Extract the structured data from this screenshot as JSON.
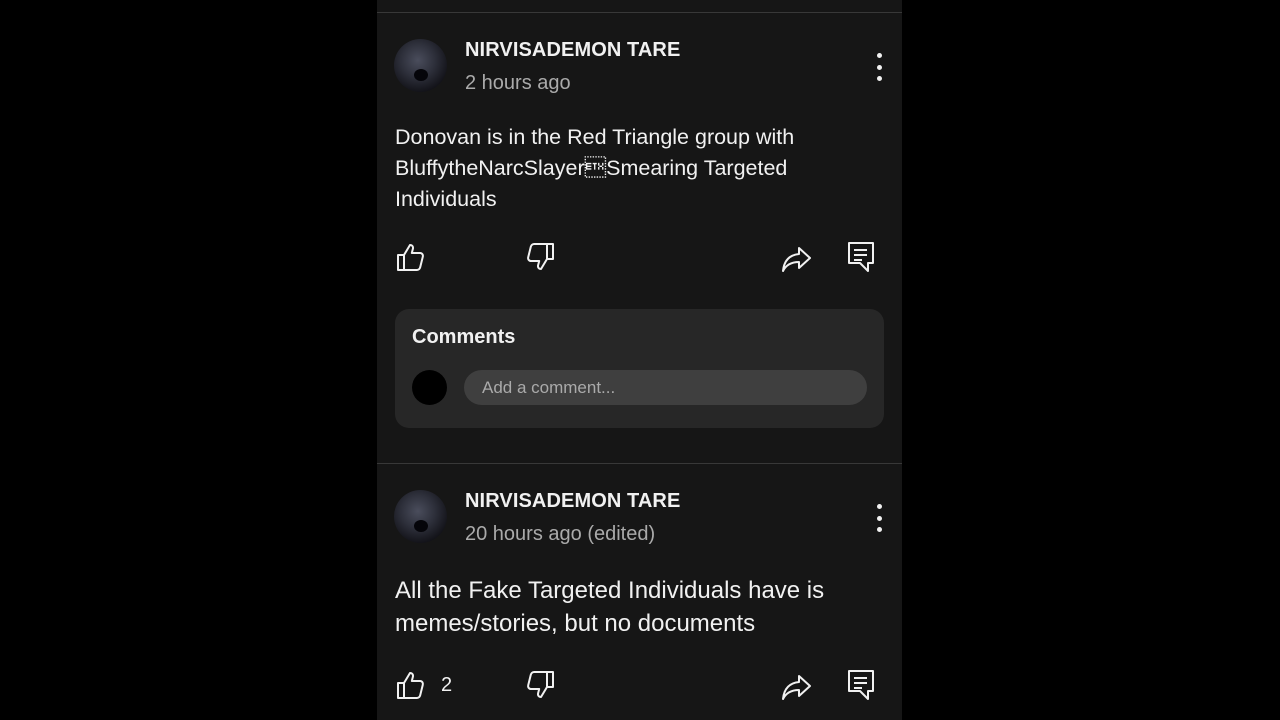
{
  "posts": [
    {
      "author": "NIRVISADEMON TARE",
      "time": "2 hours ago",
      "text": "Donovan is in the Red Triangle group with BluffytheNarcSlayer\u0003Smearing Targeted Individuals",
      "like_count": ""
    },
    {
      "author": "NIRVISADEMON TARE",
      "time": "20 hours ago (edited)",
      "text": "All the Fake Targeted Individuals have is memes/stories, but no documents",
      "like_count": "2"
    }
  ],
  "comments": {
    "title": "Comments",
    "placeholder": "Add a comment..."
  },
  "icons": {
    "like": "thumbs-up-icon",
    "dislike": "thumbs-down-icon",
    "share": "share-icon",
    "reply": "comment-icon",
    "more": "more-vert-icon"
  },
  "colors": {
    "background": "#000000",
    "panel": "#161616",
    "card": "#272727",
    "text": "#f1f1f1",
    "secondary_text": "#aaaaaa"
  }
}
